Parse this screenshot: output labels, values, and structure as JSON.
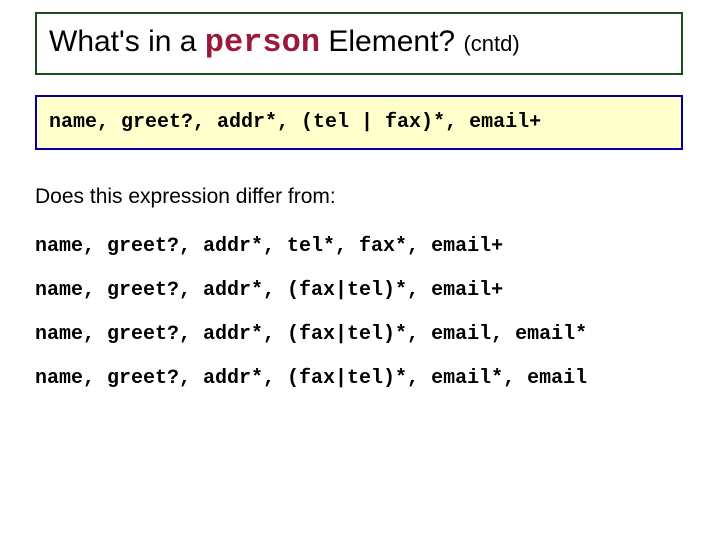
{
  "title": {
    "part1": "What's in a ",
    "code": "person",
    "part2": " Element? ",
    "suffix": "(cntd)"
  },
  "code_block": "name, greet?, addr*, (tel | fax)*, email+",
  "question": "Does this expression differ from:",
  "expressions": [
    "name, greet?, addr*, tel*, fax*, email+",
    "name, greet?, addr*, (fax|tel)*, email+",
    "name, greet?, addr*, (fax|tel)*, email, email*",
    "name, greet?, addr*, (fax|tel)*, email*, email"
  ]
}
